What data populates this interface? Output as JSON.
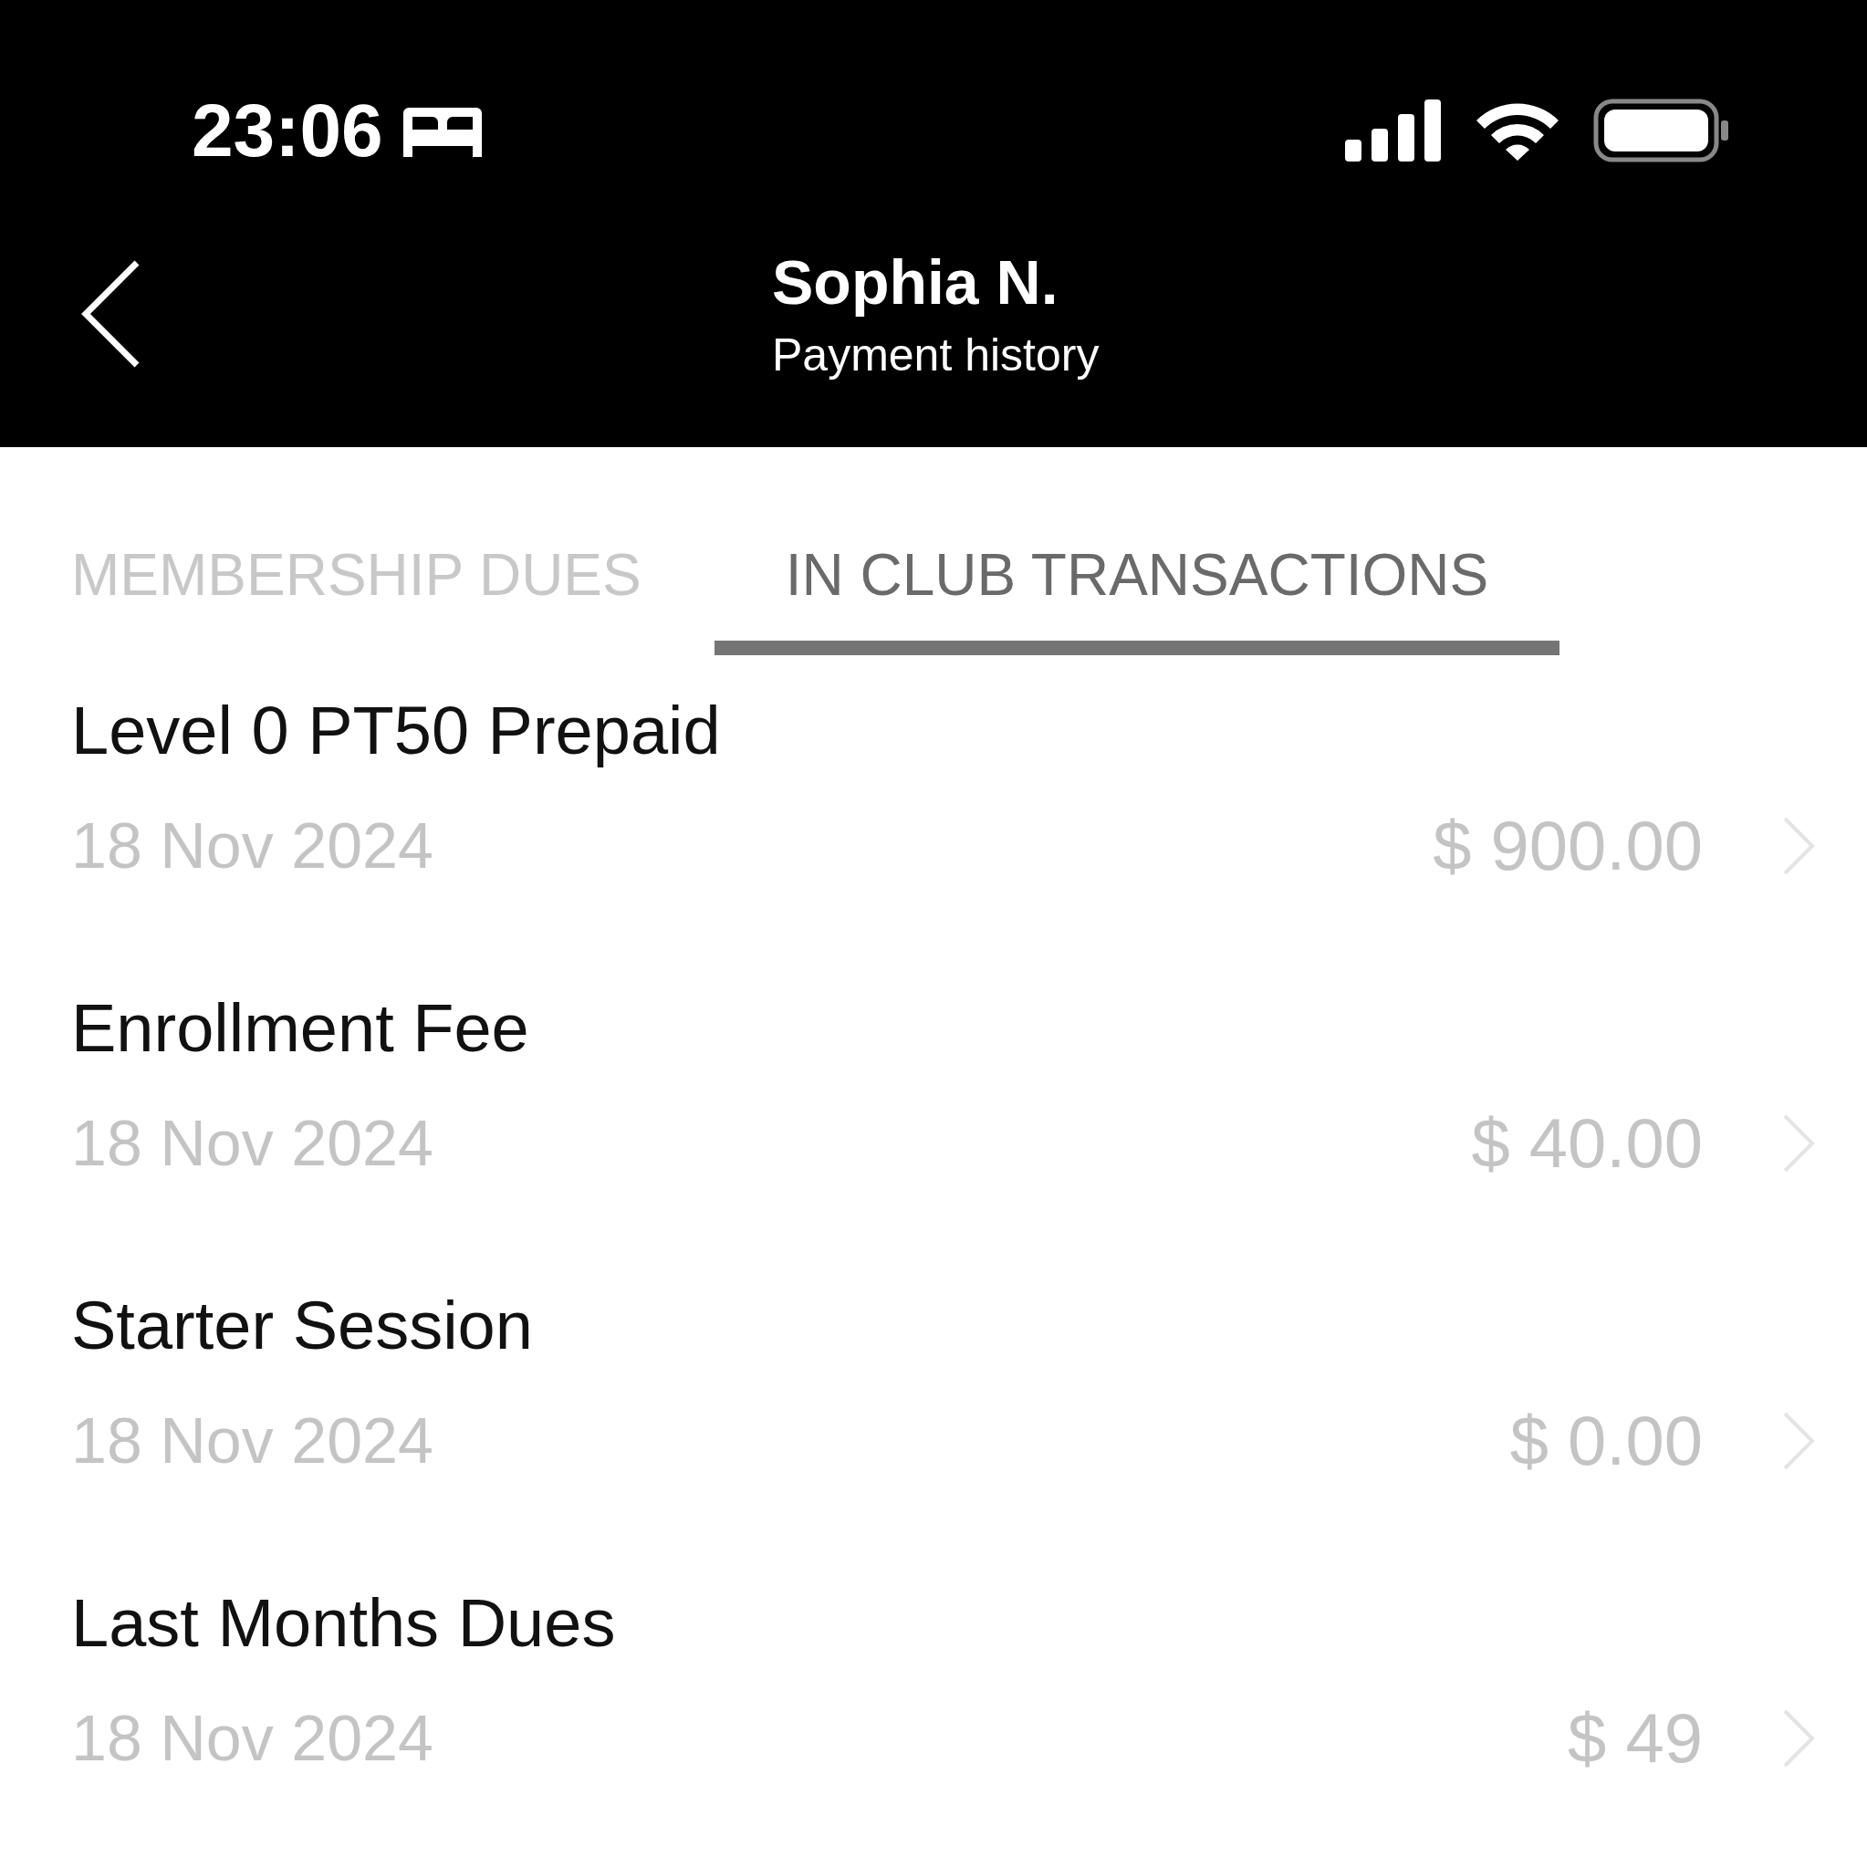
{
  "status_bar": {
    "time": "23:06"
  },
  "header": {
    "title": "Sophia N.",
    "subtitle": "Payment history"
  },
  "tabs": [
    {
      "label": "MEMBERSHIP DUES",
      "selected": false
    },
    {
      "label": "IN CLUB TRANSACTIONS",
      "selected": true
    }
  ],
  "transactions": [
    {
      "name": "Level 0 PT50 Prepaid",
      "date": "18 Nov 2024",
      "amount": "$ 900.00"
    },
    {
      "name": "Enrollment Fee",
      "date": "18 Nov 2024",
      "amount": "$ 40.00"
    },
    {
      "name": "Starter Session",
      "date": "18 Nov 2024",
      "amount": "$ 0.00"
    },
    {
      "name": "Last Months Dues",
      "date": "18 Nov 2024",
      "amount": "$ 49"
    }
  ]
}
